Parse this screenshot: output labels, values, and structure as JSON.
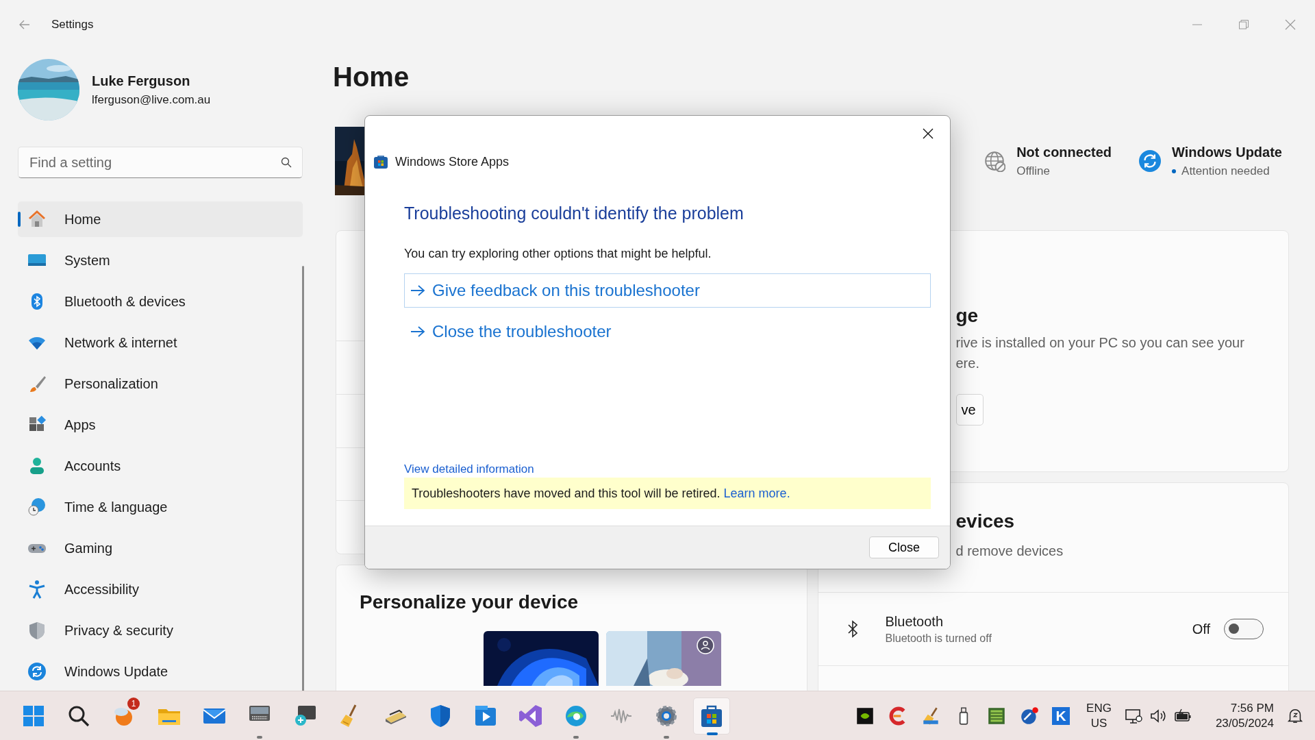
{
  "window": {
    "title": "Settings"
  },
  "account": {
    "name": "Luke Ferguson",
    "email": "lferguson@live.com.au"
  },
  "search": {
    "placeholder": "Find a setting"
  },
  "nav": [
    {
      "label": "Home",
      "selected": true
    },
    {
      "label": "System",
      "selected": false
    },
    {
      "label": "Bluetooth & devices",
      "selected": false
    },
    {
      "label": "Network & internet",
      "selected": false
    },
    {
      "label": "Personalization",
      "selected": false
    },
    {
      "label": "Apps",
      "selected": false
    },
    {
      "label": "Accounts",
      "selected": false
    },
    {
      "label": "Time & language",
      "selected": false
    },
    {
      "label": "Gaming",
      "selected": false
    },
    {
      "label": "Accessibility",
      "selected": false
    },
    {
      "label": "Privacy & security",
      "selected": false
    },
    {
      "label": "Windows Update",
      "selected": false
    }
  ],
  "page": {
    "heading": "Home"
  },
  "status": [
    {
      "title": "Not connected",
      "subtitle": "Offline",
      "alert": false
    },
    {
      "title": "Windows Update",
      "subtitle": "Attention needed",
      "alert": true
    }
  ],
  "storage_card": {
    "heading": "ge",
    "body_lines": [
      "rive is installed on your PC so you can see your",
      "ere."
    ],
    "button": "ve"
  },
  "devices_card": {
    "heading": "evices",
    "body": "d remove devices",
    "rows": [
      {
        "title": "Bluetooth",
        "subtitle": "Bluetooth is turned off",
        "state_label": "Off",
        "on": false
      }
    ]
  },
  "personalize_card": {
    "heading": "Personalize your device"
  },
  "dialog": {
    "app": "Windows Store Apps",
    "heading": "Troubleshooting couldn't identify the problem",
    "message": "You can try exploring other options that might be helpful.",
    "options": [
      {
        "label": "Give feedback on this troubleshooter",
        "focused": true
      },
      {
        "label": "Close the troubleshooter",
        "focused": false
      }
    ],
    "details_link": "View detailed information",
    "notice": "Troubleshooters have moved and this tool will be retired.",
    "notice_link": "Learn more.",
    "button": "Close"
  },
  "taskbar": {
    "apps": [
      {
        "running": false,
        "active": false
      },
      {
        "running": false,
        "active": false
      },
      {
        "running": false,
        "active": false,
        "badge": "1"
      },
      {
        "running": false,
        "active": false
      },
      {
        "running": false,
        "active": false
      },
      {
        "running": true,
        "active": false
      },
      {
        "running": false,
        "active": false
      },
      {
        "running": false,
        "active": false
      },
      {
        "running": false,
        "active": false
      },
      {
        "running": false,
        "active": false
      },
      {
        "running": false,
        "active": false
      },
      {
        "running": false,
        "active": false
      },
      {
        "running": true,
        "active": false
      },
      {
        "running": false,
        "active": false
      },
      {
        "running": true,
        "active": false
      },
      {
        "running": true,
        "active": true
      }
    ],
    "tray_app_label": "K",
    "language": "ENG",
    "region": "US",
    "time": "7:56 PM",
    "date": "23/05/2024"
  }
}
